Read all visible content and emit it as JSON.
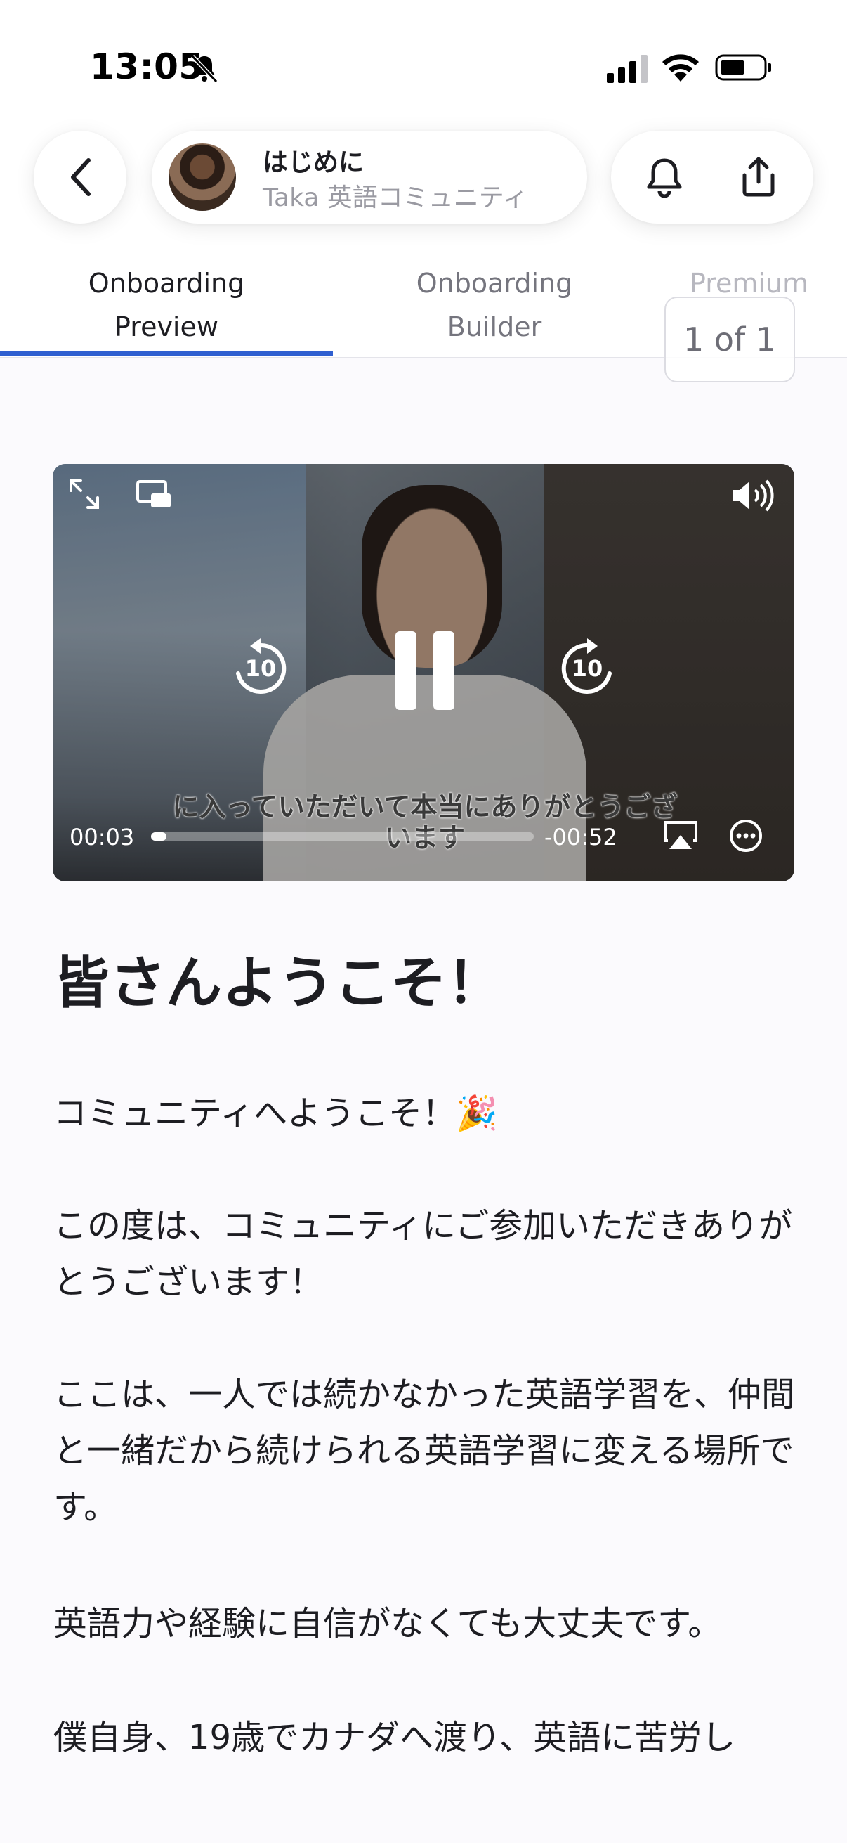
{
  "status_bar": {
    "time": "13:05"
  },
  "header": {
    "space_title": "はじめに",
    "space_subtitle": "Taka 英語コミュニティ"
  },
  "tabs": [
    {
      "label": "Onboarding\nPreview",
      "active": true
    },
    {
      "label": "Onboarding\nBuilder",
      "active": false
    },
    {
      "label": "Premium",
      "active": false
    }
  ],
  "page_indicator": "1 of 1",
  "video": {
    "elapsed": "00:03",
    "remaining": "-00:52",
    "progress": 0.04,
    "caption": "に入っていただいて本当にありがとうござ\nいます",
    "skip_back_seconds": "10",
    "skip_forward_seconds": "10"
  },
  "article": {
    "heading": "皆さんようこそ！",
    "paragraphs": [
      "コミュニティへようこそ！🎉",
      "この度は、コミュニティにご参加いただきありがとうございます！",
      "ここは、一人では続かなかった英語学習を、仲間と一緒だから続けられる英語学習に変える場所です。",
      "英語力や経験に自信がなくても大丈夫です。",
      "僕自身、19歳でカナダへ渡り、英語に苦労し"
    ]
  },
  "colors": {
    "accent": "#2f5fd0",
    "background": "#fbfafd"
  }
}
